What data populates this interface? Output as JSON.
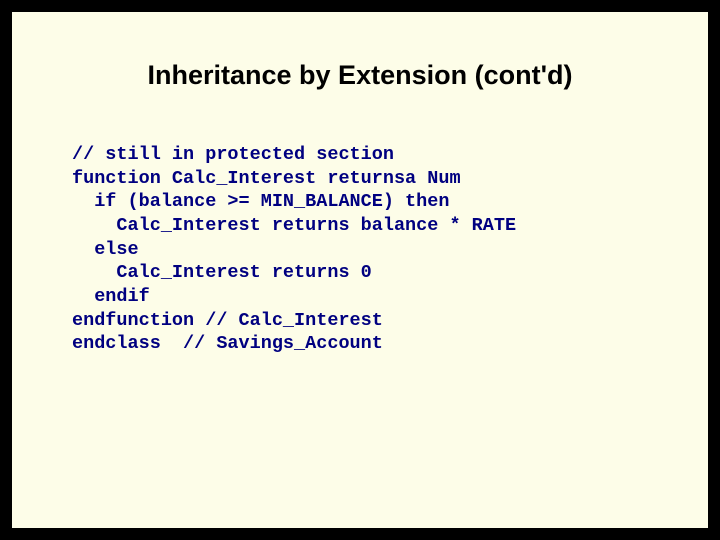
{
  "slide": {
    "title": "Inheritance by Extension (cont'd)",
    "code_lines": {
      "l1": "// still in protected section",
      "l2": "function Calc_Interest returnsa Num",
      "l3": "  if (balance >= MIN_BALANCE) then",
      "l4": "    Calc_Interest returns balance * RATE",
      "l5": "  else",
      "l6": "    Calc_Interest returns 0",
      "l7": "  endif",
      "l8": "endfunction // Calc_Interest",
      "l9": "",
      "l10": "endclass  // Savings_Account"
    }
  }
}
